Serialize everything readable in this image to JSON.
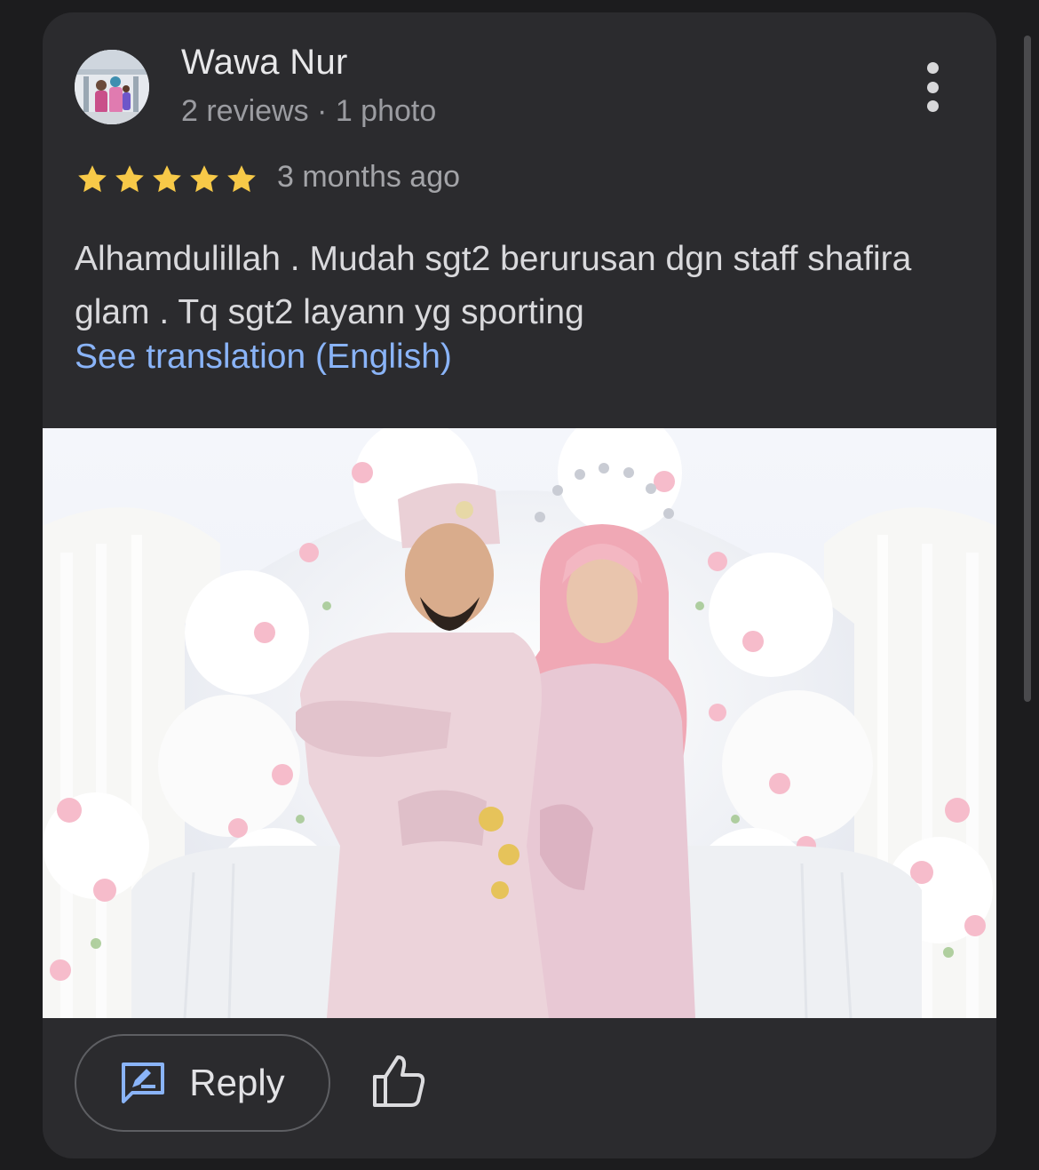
{
  "review": {
    "author": "Wawa Nur",
    "author_meta": "2 reviews · 1 photo",
    "rating": 5,
    "time_ago": "3 months ago",
    "text": "Alhamdulillah . Mudah sgt2 berurusan dgn staff shafira glam . Tq sgt2 layann yg sporting",
    "translation_link": "See translation (English)"
  },
  "actions": {
    "reply_label": "Reply"
  },
  "colors": {
    "background": "#1c1c1e",
    "card": "#2b2b2e",
    "star": "#f7c948",
    "link": "#8ab4f8",
    "reply_icon": "#8ab4f8"
  },
  "icons": {
    "more": "more-vert-icon",
    "star": "star-icon",
    "reply": "reply-icon",
    "like": "thumb-up-icon"
  }
}
